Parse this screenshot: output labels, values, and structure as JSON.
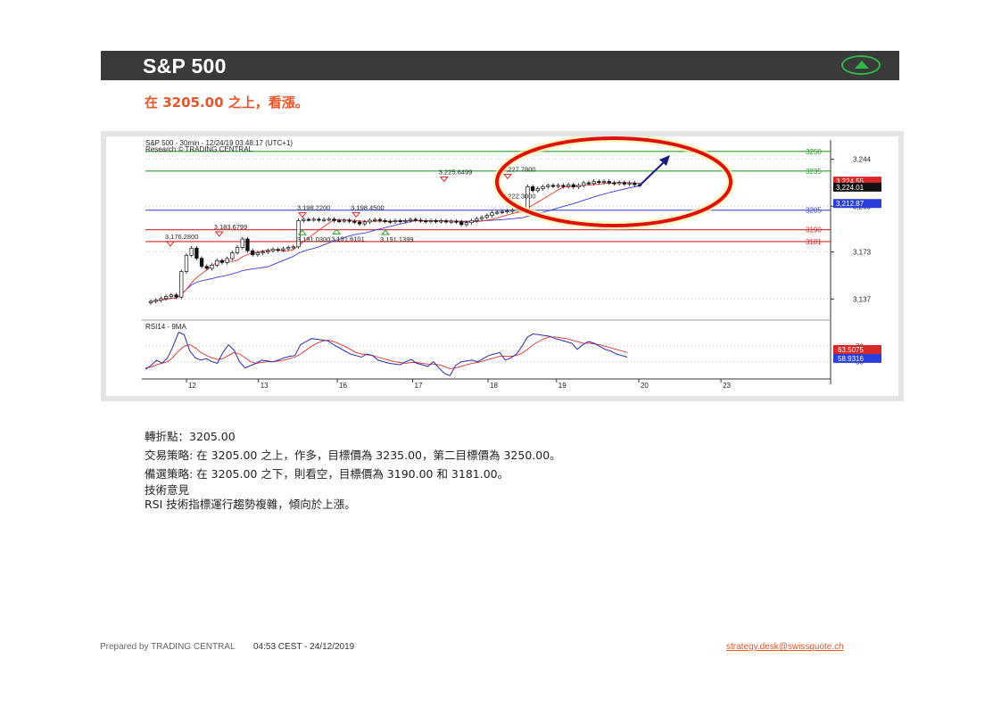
{
  "header": {
    "title": "S&P 500",
    "trend_icon": "up-arrow-icon",
    "accent": "#2fb84a"
  },
  "headline": "在  3205.00 之上，看漲。",
  "chart_data": {
    "type": "candlestick",
    "title": "S&P 500 - 30min - 12/24/19 03:48:17 (UTC+1)",
    "subtitle": "Research © TRADING CENTRAL",
    "x_ticks": [
      "12",
      "13",
      "16",
      "17",
      "18",
      "19",
      "20",
      "23"
    ],
    "y_ticks": [
      3244,
      3208,
      3173,
      3137
    ],
    "y_tick_labels": [
      "3,244",
      "3,208",
      "3,173",
      "3,137"
    ],
    "ylim": [
      3125,
      3256
    ],
    "levels": [
      {
        "value": 3250,
        "label": "3250",
        "color": "#2e9a2e"
      },
      {
        "value": 3235,
        "label": "3235",
        "color": "#2e9a2e"
      },
      {
        "value": 3205,
        "label": "3205",
        "color": "#2a3fd8"
      },
      {
        "value": 3190,
        "label": "3190",
        "color": "#d62828"
      },
      {
        "value": 3181,
        "label": "3181",
        "color": "#d62828"
      }
    ],
    "price_tags": [
      {
        "value": 3224.55,
        "label": "3,224.55",
        "color": "#d62828"
      },
      {
        "value": 3224.01,
        "label": "3,224.01",
        "color": "#111111"
      },
      {
        "value": 3212.87,
        "label": "3,212.87",
        "color": "#2a3fd8"
      }
    ],
    "annotations": [
      {
        "text": "3,176.2800",
        "type": "high",
        "x": 0.04,
        "value": 3176.28
      },
      {
        "text": "3,183.6799",
        "type": "high",
        "x": 0.14,
        "value": 3183.68
      },
      {
        "text": "3,198.2200",
        "type": "high",
        "x": 0.31,
        "value": 3198.22
      },
      {
        "text": "3,198.4500",
        "type": "high",
        "x": 0.42,
        "value": 3198.45
      },
      {
        "text": "3,225.6499",
        "type": "high",
        "x": 0.6,
        "value": 3225.65
      },
      {
        "text": "3,227.7800",
        "type": "high",
        "x": 0.73,
        "value": 3227.78
      },
      {
        "text": "3,191.0300",
        "type": "low",
        "x": 0.31,
        "value": 3191.03
      },
      {
        "text": "3,191.6101",
        "type": "low",
        "x": 0.38,
        "value": 3191.61
      },
      {
        "text": "3,191.1399",
        "type": "low",
        "x": 0.48,
        "value": 3191.14
      },
      {
        "text": "3,222.3000",
        "type": "label",
        "x": 0.73,
        "value": 3222.3
      }
    ],
    "close": [
      3135.2,
      3136.1,
      3137.4,
      3139.0,
      3140.2,
      3138.5,
      3158.0,
      3170.5,
      3176.0,
      3168.2,
      3162.0,
      3160.5,
      3163.0,
      3166.5,
      3165.0,
      3168.0,
      3172.5,
      3176.5,
      3183.0,
      3174.0,
      3171.0,
      3172.5,
      3173.0,
      3174.0,
      3175.0,
      3174.5,
      3175.5,
      3176.5,
      3177.0,
      3197.0,
      3198.0,
      3197.8,
      3198.1,
      3197.5,
      3197.9,
      3198.2,
      3197.0,
      3196.8,
      3197.4,
      3196.5,
      3196.0,
      3194.5,
      3196.0,
      3197.3,
      3197.9,
      3197.1,
      3196.6,
      3196.2,
      3197.0,
      3196.5,
      3197.0,
      3198.0,
      3197.4,
      3196.9,
      3196.5,
      3197.0,
      3196.4,
      3196.8,
      3196.2,
      3196.6,
      3196.1,
      3194.0,
      3195.5,
      3197.0,
      3198.5,
      3199.5,
      3201.0,
      3203.0,
      3203.5,
      3204.0,
      3204.5,
      3205.0,
      3206.0,
      3205.5,
      3223.0,
      3220.0,
      3221.5,
      3223.0,
      3224.0,
      3223.5,
      3224.0,
      3223.2,
      3224.5,
      3222.8,
      3224.0,
      3226.0,
      3225.5,
      3227.0,
      3226.4,
      3227.0,
      3226.0,
      3225.5,
      3226.2,
      3225.0,
      3225.8,
      3224.5,
      3224.0
    ],
    "ma_fast_name": "",
    "rsi": {
      "label": "RSI14 - 9MA",
      "ticks": [
        70,
        50
      ],
      "ylim": [
        30,
        90
      ],
      "rsi_tag": {
        "value": 63.5,
        "label": "63.5075",
        "color": "#d62828"
      },
      "ma_tag": {
        "value": 58.9316,
        "label": "58.9316",
        "color": "#2a3fd8"
      },
      "rsi_values": [
        40,
        45,
        52,
        48,
        55,
        70,
        88,
        85,
        64,
        55,
        52,
        54,
        50,
        48,
        62,
        72,
        65,
        50,
        42,
        45,
        48,
        52,
        51,
        50,
        52,
        55,
        57,
        58,
        72,
        76,
        80,
        79,
        78,
        77,
        72,
        68,
        64,
        60,
        58,
        56,
        60,
        58,
        52,
        50,
        48,
        47,
        46,
        50,
        53,
        48,
        46,
        44,
        50,
        42,
        35,
        32,
        45,
        50,
        51,
        52,
        50,
        54,
        58,
        60,
        62,
        52,
        55,
        60,
        70,
        82,
        86,
        85,
        84,
        83,
        80,
        78,
        76,
        74,
        66,
        72,
        76,
        74,
        70,
        66,
        64,
        60,
        58,
        56
      ],
      "ma_values": [
        42,
        43,
        46,
        48,
        50,
        56,
        64,
        70,
        72,
        68,
        62,
        58,
        55,
        53,
        54,
        58,
        62,
        60,
        55,
        50,
        48,
        49,
        50,
        50,
        51,
        52,
        54,
        56,
        60,
        65,
        70,
        74,
        77,
        78,
        76,
        73,
        70,
        66,
        62,
        60,
        59,
        58,
        56,
        54,
        52,
        50,
        49,
        48,
        49,
        49,
        48,
        47,
        47,
        46,
        44,
        41,
        42,
        44,
        46,
        48,
        49,
        51,
        53,
        55,
        57,
        57,
        57,
        58,
        61,
        66,
        72,
        76,
        80,
        82,
        82,
        81,
        80,
        78,
        76,
        74,
        74,
        73,
        72,
        70,
        68,
        66,
        64,
        62
      ]
    }
  },
  "body": {
    "pivot": "轉折點：3205.00",
    "strategy": "交易策略: 在 3205.00 之上，作多，目標價為  3235.00，第二目標價為  3250.00。",
    "alternative": "備選策略: 在 3205.00 之下，則看空，目標價為  3190.00 和 3181.00。",
    "comment_heading": "技術意見",
    "comment": "RSI 技術指標運行趨勢複雜，傾向於上漲。"
  },
  "footer": {
    "prepared_by": "Prepared by TRADING CENTRAL",
    "timestamp": "04:53 CEST  - 24/12/2019",
    "email": "strategy.desk@swissquote.ch"
  }
}
